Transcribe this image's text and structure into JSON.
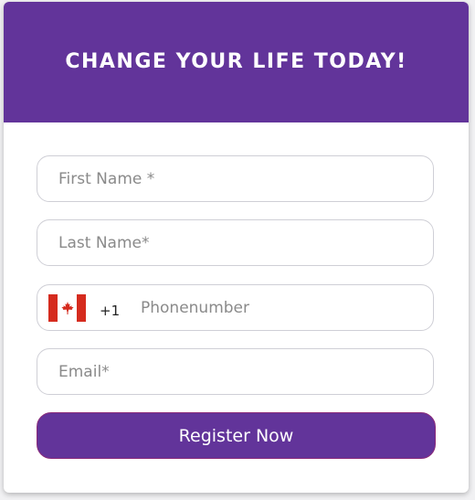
{
  "header": {
    "title": "CHANGE YOUR LIFE TODAY!"
  },
  "colors": {
    "brand": "#62349a",
    "flag_red": "#d52b1e"
  },
  "form": {
    "first_name": {
      "placeholder": "First Name *",
      "value": ""
    },
    "last_name": {
      "placeholder": "Last Name*",
      "value": ""
    },
    "phone": {
      "country_flag": "canada-flag-icon",
      "dial_code": "+1",
      "placeholder": "Phonenumber",
      "value": ""
    },
    "email": {
      "placeholder": "Email*",
      "value": ""
    },
    "submit_label": "Register Now"
  }
}
